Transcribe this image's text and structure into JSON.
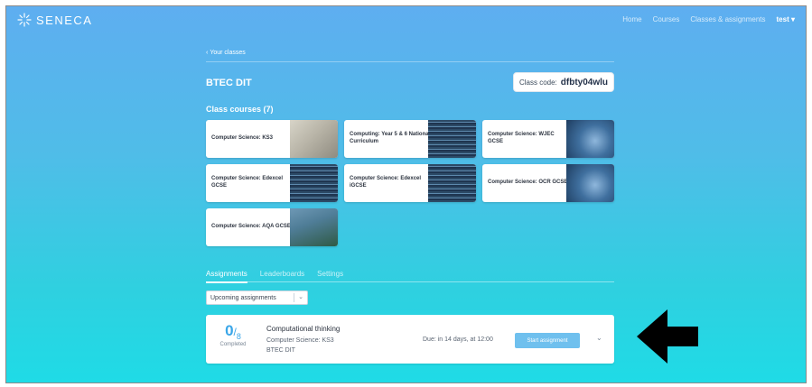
{
  "app": {
    "logo_text": "SENECA"
  },
  "nav": {
    "links": [
      "Home",
      "Courses",
      "Classes & assignments"
    ],
    "user_label": "test"
  },
  "back_link": "Your classes",
  "class": {
    "title": "BTEC DIT",
    "code_label": "Class code:",
    "code": "dfbty04wlu"
  },
  "courses": {
    "heading": "Class courses (7)",
    "items": [
      {
        "title": "Computer Science: KS3",
        "image": "retro-computer"
      },
      {
        "title": "Computing: Year 5 & 6 National Curriculum",
        "image": "code-screen"
      },
      {
        "title": "Computer Science: WJEC GCSE",
        "image": "circuit-board"
      },
      {
        "title": "Computer Science: Edexcel GCSE",
        "image": "code-screen"
      },
      {
        "title": "Computer Science: Edexcel iGCSE",
        "image": "code-screen"
      },
      {
        "title": "Computer Science: OCR GCSE",
        "image": "circuit-board"
      },
      {
        "title": "Computer Science: AQA GCSE",
        "image": "city-model"
      }
    ]
  },
  "tabs": [
    {
      "label": "Assignments",
      "active": true
    },
    {
      "label": "Leaderboards",
      "active": false
    },
    {
      "label": "Settings",
      "active": false
    }
  ],
  "filter": {
    "selected": "Upcoming assignments"
  },
  "assignment": {
    "completed": "0",
    "total": "8",
    "completed_label": "Completed",
    "title": "Computational thinking",
    "course": "Computer Science: KS3",
    "class": "BTEC DIT",
    "due": "Due: in 14 days, at 12:00",
    "start_label": "Start assignment"
  },
  "colors": {
    "accent": "#3aa6e8",
    "button": "#6fc0ee",
    "gradient_top": "#5eaef0",
    "gradient_bottom": "#1fdbe6"
  }
}
